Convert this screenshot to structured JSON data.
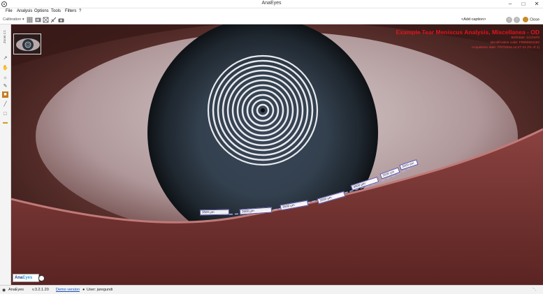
{
  "window": {
    "title": "AnaEyes"
  },
  "menu": [
    "File",
    "Analysis",
    "Options",
    "Tools",
    "Filters",
    "?"
  ],
  "toolbar": {
    "calibration_label": "Calibration",
    "add_caption": "<Add caption>",
    "close_label": "Close"
  },
  "left_tools": {
    "zoom_label": "Zoom 1:1"
  },
  "image_info": {
    "title": "Example Tear Meniscus Analysis, Miscellanea - OD",
    "lines": [
      "Birthdate: 1/1/1970",
      "Identification code: F9900551192",
      "Acquisition date: 7/07/2016 10:27:21 (#1 of 1)"
    ]
  },
  "measurements": [
    "3500 µm",
    "3500 µm",
    "3500 µm",
    "3500 µm",
    "3500 µm",
    "3500 µm",
    "3500 µm"
  ],
  "logo": {
    "text_a": "Ana",
    "text_b": "Eyes"
  },
  "status": {
    "app": "AnaEyes",
    "version": "v.3.2.1.20",
    "demo": "Demo version",
    "user": "User: jaregundi"
  },
  "colors": {
    "info_text": "#e0141c",
    "measure_box": "#5b52a8"
  }
}
